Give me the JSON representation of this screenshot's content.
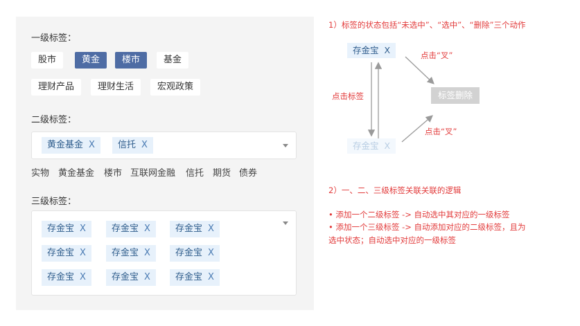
{
  "level1": {
    "label": "一级标签：",
    "tags": [
      {
        "text": "股市",
        "selected": false
      },
      {
        "text": "黄金",
        "selected": true
      },
      {
        "text": "楼市",
        "selected": true
      },
      {
        "text": "基金",
        "selected": false
      },
      {
        "text": "理财产品",
        "selected": false
      },
      {
        "text": "理财生活",
        "selected": false
      },
      {
        "text": "宏观政策",
        "selected": false
      }
    ]
  },
  "level2": {
    "label": "二级标签：",
    "chips": [
      {
        "text": "黄金基金",
        "x": "X"
      },
      {
        "text": "信托",
        "x": "X"
      }
    ],
    "options": [
      "实物",
      "黄金基金",
      "楼市",
      "互联网金融",
      "信托",
      "期货",
      "债券"
    ]
  },
  "level3": {
    "label": "三级标签：",
    "chips": [
      {
        "text": "存金宝",
        "x": "X"
      },
      {
        "text": "存金宝",
        "x": "X"
      },
      {
        "text": "存金宝",
        "x": "X"
      },
      {
        "text": "存金宝",
        "x": "X"
      },
      {
        "text": "存金宝",
        "x": "X"
      },
      {
        "text": "存金宝",
        "x": "X"
      },
      {
        "text": "存金宝",
        "x": "X"
      },
      {
        "text": "存金宝",
        "x": "X"
      },
      {
        "text": "存金宝",
        "x": "X"
      }
    ]
  },
  "notes": {
    "note1": "1）标签的状态包括“未选中”、“选中”、“删除”三个动作",
    "note2": "2）一、二、三级标签关联关联的逻辑",
    "bullet1": "• 添加一个二级标签 -> 自动选中其对应的一级标签",
    "bullet2": "• 添加一个三级标签 -> 自动添加对应的二级标签，且为",
    "bullet2_cont": "选中状态；自动选中对应的一级标签"
  },
  "diagram": {
    "tag_active": {
      "text": "存金宝",
      "x": "X"
    },
    "tag_faded": {
      "text": "存金宝",
      "x": "X"
    },
    "delete_box": "标签删除",
    "label_click_x_top": "点击“叉”",
    "label_click_tag": "点击标签",
    "label_click_x_bottom": "点击“叉”"
  },
  "colors": {
    "selected_tag_bg": "#4e6ca4",
    "chip_bg": "#e7f1fb",
    "note_red": "#e23b3b",
    "panel_bg": "#f4f4f4"
  }
}
